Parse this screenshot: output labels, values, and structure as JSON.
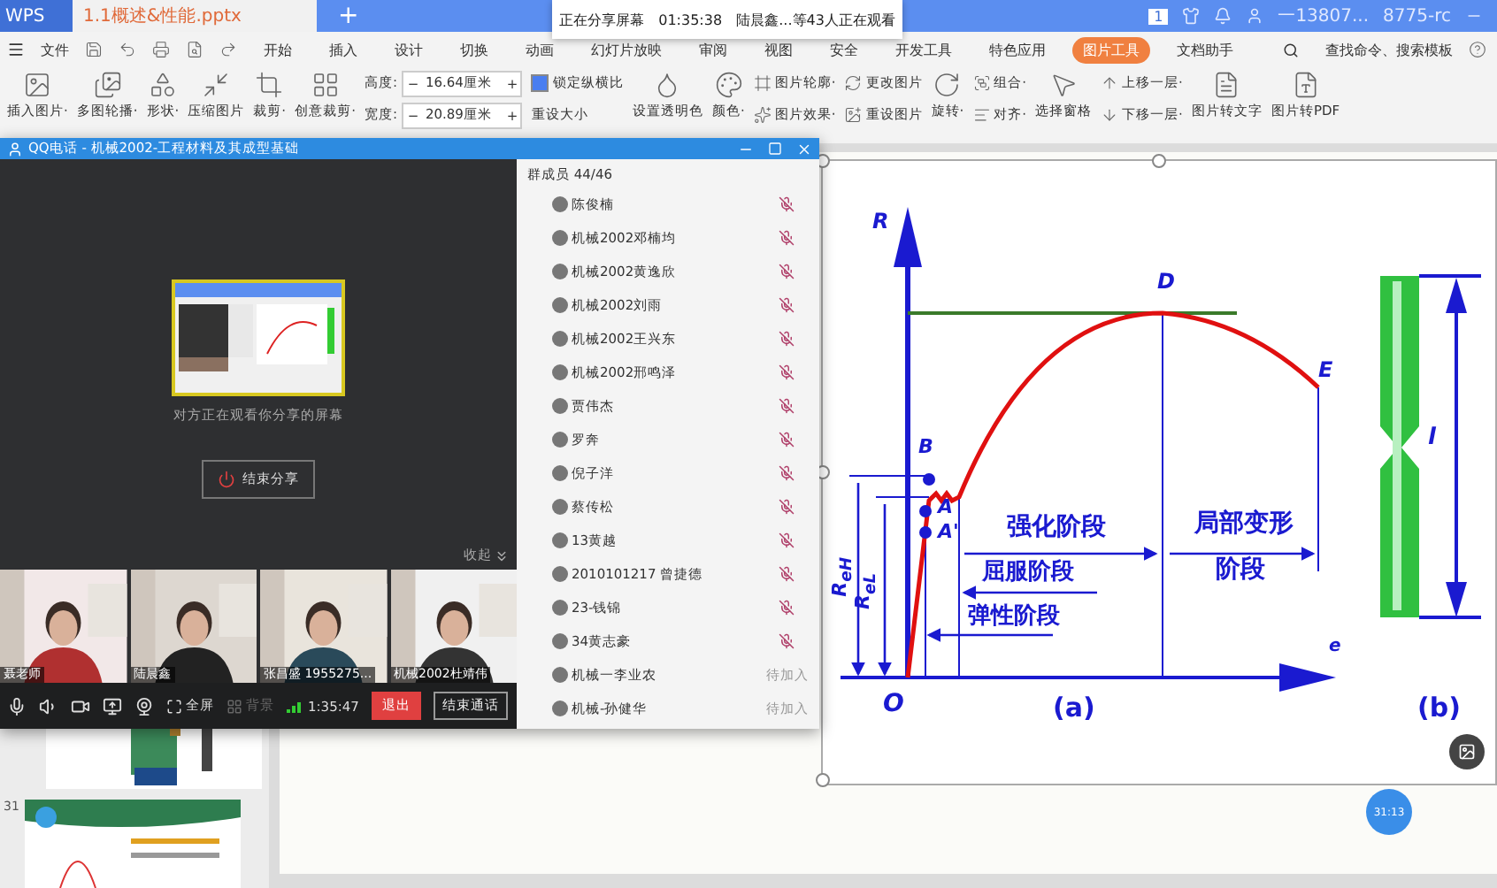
{
  "app_bar": {
    "app": "WPS",
    "document_tab": "1.1概述&性能.pptx",
    "new_tab": "+",
    "page_badge": "1",
    "user": "一13807...",
    "user_id": "8775-rc"
  },
  "share_banner": {
    "status": "正在分享屏幕",
    "time": "01:35:38",
    "viewers": "陆晨鑫...等43人正在观看"
  },
  "menu": {
    "file": "文件",
    "tabs": [
      {
        "label": "开始",
        "selected": false
      },
      {
        "label": "插入",
        "selected": false
      },
      {
        "label": "设计",
        "selected": false
      },
      {
        "label": "切换",
        "selected": false
      },
      {
        "label": "动画",
        "selected": false
      },
      {
        "label": "幻灯片放映",
        "selected": false
      },
      {
        "label": "审阅",
        "selected": false
      },
      {
        "label": "视图",
        "selected": false
      },
      {
        "label": "安全",
        "selected": false
      },
      {
        "label": "开发工具",
        "selected": false
      },
      {
        "label": "特色应用",
        "selected": false
      },
      {
        "label": "图片工具",
        "selected": true
      },
      {
        "label": "文档助手",
        "selected": false
      }
    ],
    "search": "查找命令、搜索模板"
  },
  "ribbon": {
    "large_left": [
      "插入图片·",
      "多图轮播·",
      "形状·",
      "压缩图片",
      "裁剪·",
      "创意裁剪·"
    ],
    "size_fields": [
      {
        "label": "高度:",
        "value": "16.64厘米",
        "minus": "−",
        "plus": "+"
      },
      {
        "label": "宽度:",
        "value": "20.89厘米",
        "minus": "−",
        "plus": "+"
      }
    ],
    "lock_ratio": {
      "label": "锁定纵横比",
      "checked": true
    },
    "reset_size": "重设大小",
    "large_mid": [
      "设置透明色",
      "颜色·"
    ],
    "small_mid": [
      "图片轮廓·",
      "图片效果·",
      "更改图片",
      "重设图片"
    ],
    "rotate": "旋转·",
    "small_arrange": [
      "组合·",
      "对齐·"
    ],
    "select_pane": "选择窗格",
    "small_layer": [
      "上移一层·",
      "下移一层·"
    ],
    "large_right": [
      "图片转文字",
      "图片转PDF"
    ]
  },
  "qq_call": {
    "title": "QQ电话 - 机械2002-工程材料及其成型基础",
    "sharing_note": "对方正在观看你分享的屏幕",
    "stop_share": "结束分享",
    "collapse": "收起",
    "videos": [
      {
        "name": "聂老师"
      },
      {
        "name": "陆晨鑫"
      },
      {
        "name": "张昌盛 1955275..."
      },
      {
        "name": "机械2002杜靖伟"
      }
    ],
    "toolbar": {
      "fullscreen": "全屏",
      "background": {
        "label": "背景",
        "disabled": true
      },
      "duration": "1:35:47",
      "exit": "退出",
      "end_call": "结束通话"
    },
    "members": {
      "header": "群成员 44/46",
      "items": [
        {
          "name": "陈俊楠",
          "muted": true
        },
        {
          "name": "机械2002邓楠均",
          "muted": true
        },
        {
          "name": "机械2002黄逸欣",
          "muted": true
        },
        {
          "name": "机械2002刘雨",
          "muted": true
        },
        {
          "name": "机械2002王兴东",
          "muted": true
        },
        {
          "name": "机械2002邢鸣泽",
          "muted": true
        },
        {
          "name": "贾伟杰",
          "muted": true
        },
        {
          "name": "罗奔",
          "muted": true
        },
        {
          "name": "倪子洋",
          "muted": true
        },
        {
          "name": "蔡传松",
          "muted": true
        },
        {
          "name": "13黄越",
          "muted": true
        },
        {
          "name": "2010101217 曾捷德",
          "muted": true
        },
        {
          "name": "23-钱锦",
          "muted": true
        },
        {
          "name": "34黄志豪",
          "muted": true
        },
        {
          "name": "机械一李业农",
          "muted": false,
          "status": "待加入"
        },
        {
          "name": "机械-孙健华",
          "muted": false,
          "status": "待加入"
        }
      ]
    }
  },
  "slide_panel": {
    "slide_number": "31"
  },
  "diagram": {
    "labels": [
      "R",
      "D",
      "E",
      "B",
      "l",
      "A",
      "A'",
      "O",
      "e",
      "强化阶段",
      "局部变形",
      "屈服阶段",
      "阶段",
      "弹性阶段",
      "(a)",
      "(b)",
      "R$_{eH}$",
      "R$_{eL}$"
    ]
  },
  "timer_badge": "31:13"
}
